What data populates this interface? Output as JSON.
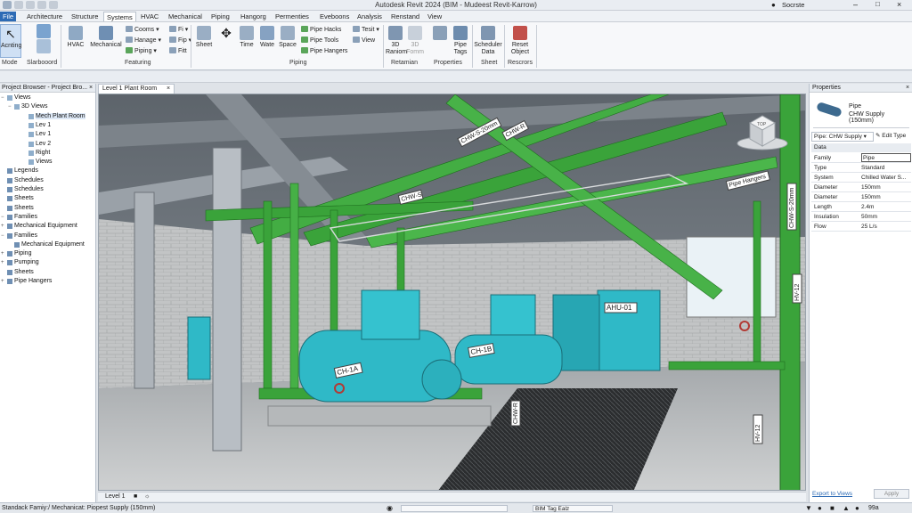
{
  "app": {
    "title": "Autodesk Revit 2024  (BIM - Mudeest Revit-Karrow)",
    "user": "Socrste"
  },
  "tabs": [
    {
      "label": "File"
    },
    {
      "label": "Architecture"
    },
    {
      "label": "Structure"
    },
    {
      "label": "Systems"
    },
    {
      "label": "HVAC"
    },
    {
      "label": "Mechanical"
    },
    {
      "label": "Piping"
    },
    {
      "label": "Hangorg"
    },
    {
      "label": "Permenties"
    },
    {
      "label": "Eveboons"
    },
    {
      "label": "Analysis"
    },
    {
      "label": "Renstand"
    },
    {
      "label": "View"
    }
  ],
  "ribbon": {
    "modify": {
      "label": "Acnting",
      "panel": "Mode"
    },
    "slarboard": "Slarbooord",
    "hvac": "HVAC",
    "mechanical": "Mechanical",
    "small_col1": [
      "Cooms",
      "Hanage",
      "Piping"
    ],
    "small_col2": [
      "Fi",
      "Fip",
      "Fitt"
    ],
    "featuring": "Featuring",
    "sheet": "Sheet",
    "time": "Time",
    "wate": "Wate",
    "space": "Space",
    "small_col3": [
      "Pipe Hacks",
      "Pipe Tools",
      "Pipe Hangers"
    ],
    "small_col4": [
      "Tesit",
      "View"
    ],
    "piping_panel": "Piping",
    "btn_3d_rainom": "3D Raniom",
    "btn_3d_fomm": "3D Fomm",
    "retamian": "Retamian",
    "pipe_tags": "Pipe Tags",
    "properties_panel": "Properties",
    "scheduler": "Scheduler Data",
    "sheet_panel": "Sheet",
    "reset": "Reset Object",
    "rescrors": "Rescrors"
  },
  "browser": {
    "header": "Project Browser - Project Bro...",
    "items": [
      {
        "label": "Views",
        "toggle": "−"
      },
      {
        "label": "3D Views",
        "toggle": "−"
      },
      {
        "label": "Mech Plant Room",
        "toggle": ""
      },
      {
        "label": "Lev 1",
        "toggle": ""
      },
      {
        "label": "Lev 1",
        "toggle": ""
      },
      {
        "label": "Lev 2",
        "toggle": ""
      },
      {
        "label": "Right",
        "toggle": ""
      },
      {
        "label": "Views",
        "toggle": ""
      },
      {
        "label": "Legends",
        "toggle": ""
      },
      {
        "label": "Schedules",
        "toggle": ""
      },
      {
        "label": "Schedules",
        "toggle": ""
      },
      {
        "label": "Sheets",
        "toggle": ""
      },
      {
        "label": "Sheets",
        "toggle": ""
      },
      {
        "label": "Families",
        "toggle": "−"
      },
      {
        "label": "Mechanical Equipment",
        "toggle": "+"
      },
      {
        "label": "Families",
        "toggle": "−"
      },
      {
        "label": "Mechanical Equipment",
        "toggle": ""
      },
      {
        "label": "Piping",
        "toggle": "+"
      },
      {
        "label": "Pumping",
        "toggle": "+"
      },
      {
        "label": "Sheets",
        "toggle": ""
      },
      {
        "label": "Pipe Hangers",
        "toggle": "+"
      }
    ]
  },
  "view_tab": {
    "label": "Level 1 Plant Room"
  },
  "viewport": {
    "viewcube_label": "TOP",
    "tags": [
      "CHW-S-20mm",
      "CHW-R",
      "CHW-S",
      "Pipe Hangers",
      "CHW-S-20mm",
      "HV-12",
      "HV-12",
      "CHW-R",
      "CH-1A",
      "CH-1B",
      "AHU-01"
    ]
  },
  "properties": {
    "header": "Properties",
    "type_name": "Pipe",
    "type_sub": "CHW Supply (150mm)",
    "selector": "Pipe: CHW Supply",
    "edit_type": "Edit Type",
    "section": "Data",
    "rows": [
      {
        "k": "Family",
        "v": "Pipe"
      },
      {
        "k": "Type",
        "v": "Standard"
      },
      {
        "k": "System",
        "v": "Chilled Water S..."
      },
      {
        "k": "Diameter",
        "v": "150mm"
      },
      {
        "k": "Diameter",
        "v": "150mm"
      },
      {
        "k": "Length",
        "v": "2.4m"
      },
      {
        "k": "Insulation",
        "v": "50mm"
      },
      {
        "k": "Flow",
        "v": "25 L/s"
      }
    ],
    "link": "Export to Views",
    "apply": "Apply"
  },
  "view_control": {
    "scale": "Level 1"
  },
  "status": {
    "text": "Standack Famiy:/ Mechanicat: Piopest Supply (150mm)",
    "field": "BIM Tag Ealz",
    "zoom": "99a"
  },
  "colors": {
    "pipe": "#3aa33a",
    "equipment": "#2fb9c7",
    "accent": "#2d6bb5"
  }
}
